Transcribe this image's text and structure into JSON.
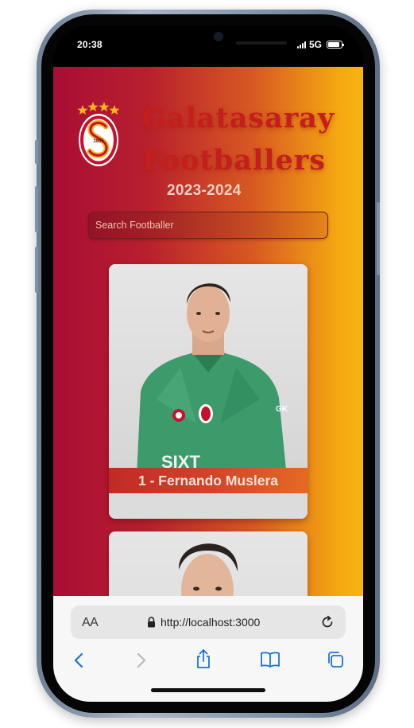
{
  "status_bar": {
    "time": "20:38",
    "network": "5G"
  },
  "header": {
    "logo_icon": "galatasaray-crest-icon",
    "logo_year": "1905",
    "title_line_1": "Galatasaray",
    "title_line_2": "Footballers",
    "season": "2023-2024"
  },
  "search": {
    "placeholder": "Search Footballer"
  },
  "players": [
    {
      "label": "1 - Fernando Muslera"
    },
    {
      "label": ""
    }
  ],
  "browser": {
    "text_size_label": "AA",
    "url": "http://localhost:3000",
    "icons": [
      "lock-icon",
      "reload-icon",
      "back-icon",
      "forward-icon",
      "share-icon",
      "bookmarks-icon",
      "tabs-icon"
    ]
  },
  "colors": {
    "brand_red": "#a90d34",
    "brand_yellow": "#f8b513",
    "title_red": "#c41e1e"
  }
}
